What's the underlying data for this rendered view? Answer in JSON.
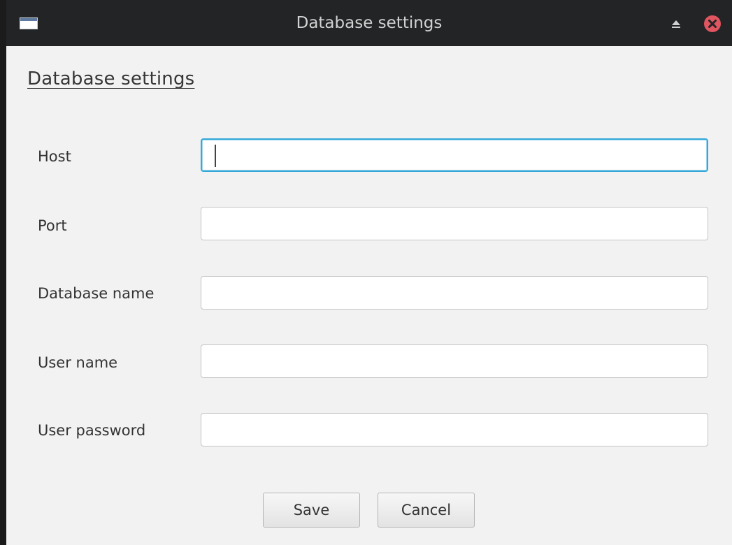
{
  "window": {
    "title": "Database settings",
    "icons": {
      "app": "window-app-icon",
      "eject": "eject-icon",
      "close": "close-icon"
    },
    "colors": {
      "titlebar": "#222426",
      "close": "#e05560",
      "focus": "#35a8d8"
    }
  },
  "form": {
    "heading": "Database settings",
    "fields": [
      {
        "label": "Host",
        "value": "",
        "placeholder": ""
      },
      {
        "label": "Port",
        "value": "",
        "placeholder": ""
      },
      {
        "label": "Database name",
        "value": "",
        "placeholder": ""
      },
      {
        "label": "User name",
        "value": "",
        "placeholder": ""
      },
      {
        "label": "User password",
        "value": "",
        "placeholder": ""
      }
    ],
    "focused_field": "Host"
  },
  "buttons": {
    "save": "Save",
    "cancel": "Cancel"
  }
}
